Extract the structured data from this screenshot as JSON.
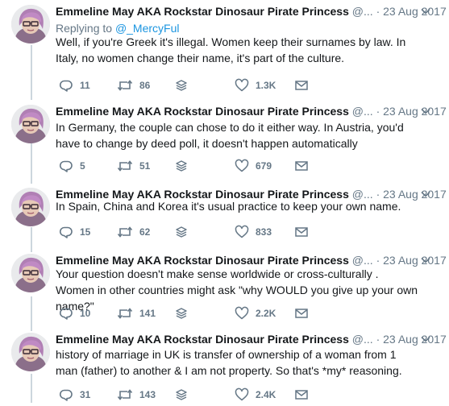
{
  "tweets": [
    {
      "name": "Emmeline May AKA Rockstar Dinosaur Pirate Princess",
      "handle": "@...",
      "dot": "·",
      "date": "23 Aug 2017",
      "reply_prefix": "Replying to",
      "reply_handle": "@_MercyFul",
      "text": "Well, if you're Greek it's illegal. Women keep their surnames by law. In Italy, no women change their name, it's part of the culture.",
      "replies": "11",
      "retweets": "86",
      "likes": "1.3K"
    },
    {
      "name": "Emmeline May AKA Rockstar Dinosaur Pirate Princess",
      "handle": "@...",
      "dot": "·",
      "date": "23 Aug 2017",
      "text": "In Germany, the couple can chose to do it either way. In Austria, you'd have to change by deed poll, it doesn't happen automatically",
      "replies": "5",
      "retweets": "51",
      "likes": "679"
    },
    {
      "name": "Emmeline May AKA Rockstar Dinosaur Pirate Princess",
      "handle": "@...",
      "dot": "·",
      "date": "23 Aug 2017",
      "text": "In Spain, China and Korea it's usual practice to keep your own name.",
      "replies": "15",
      "retweets": "62",
      "likes": "833"
    },
    {
      "name": "Emmeline May AKA Rockstar Dinosaur Pirate Princess",
      "handle": "@...",
      "dot": "·",
      "date": "23 Aug 2017",
      "text": "Your question doesn't make sense worldwide or cross-culturally . Women in other countries might ask \"why WOULD you give up your own name?\"",
      "replies": "10",
      "retweets": "141",
      "likes": "2.2K"
    },
    {
      "name": "Emmeline May AKA Rockstar Dinosaur Pirate Princess",
      "handle": "@...",
      "dot": "·",
      "date": "23 Aug 2017",
      "text": "history of marriage in UK is transfer of ownership of a woman from 1 man (father) to another & I am not property. So that's *my* reasoning.",
      "replies": "31",
      "retweets": "143",
      "likes": "2.4K"
    }
  ],
  "icons": {
    "reply": "reply-icon",
    "retweet": "retweet-icon",
    "stack": "stack-icon",
    "like": "heart-icon",
    "message": "envelope-icon",
    "caret": "chevron-down-icon"
  },
  "colors": {
    "name": "#14171a",
    "meta": "#657786",
    "link": "#1b95e0",
    "thread_line": "#ccd6dd"
  }
}
